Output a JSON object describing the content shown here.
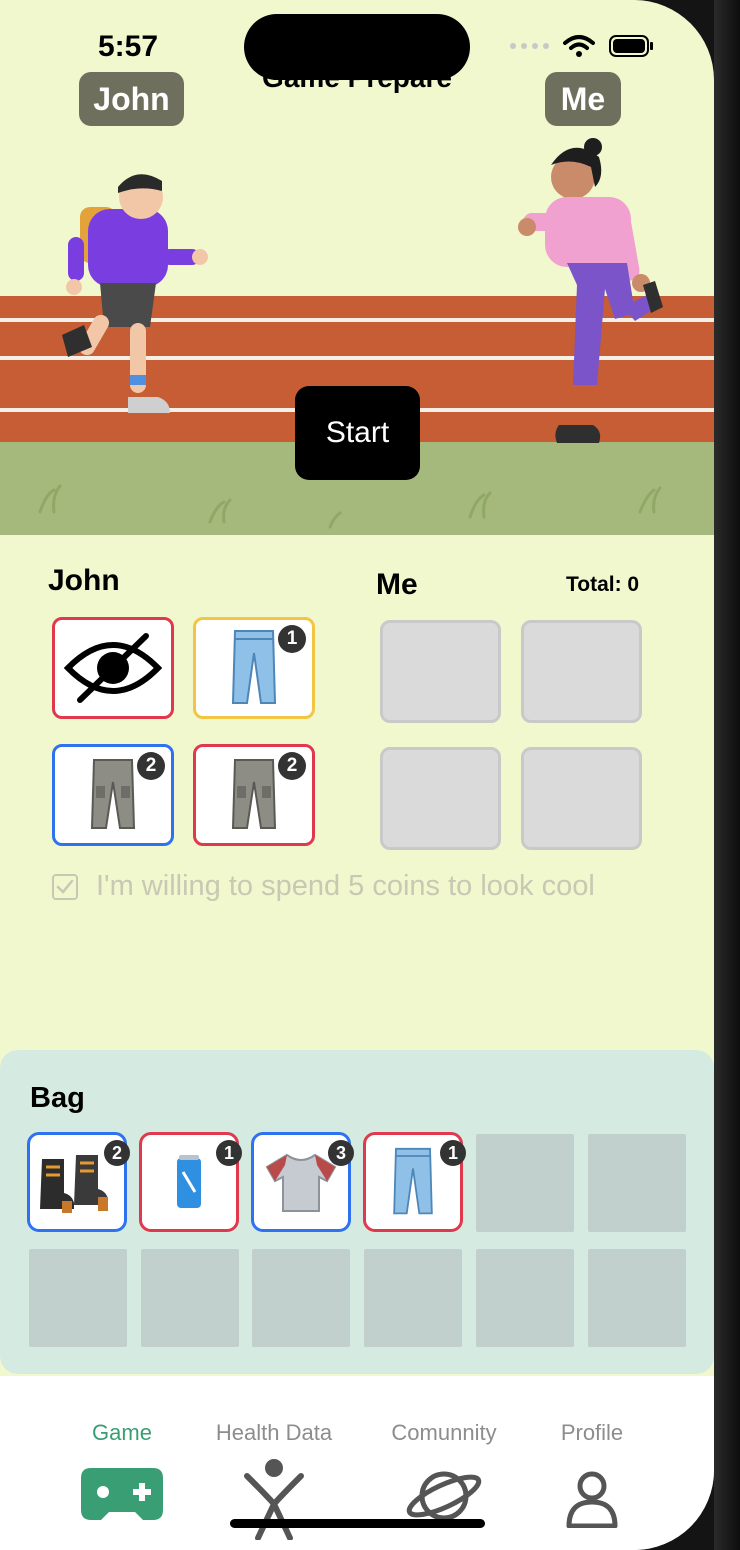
{
  "status_bar": {
    "time": "5:57"
  },
  "hero": {
    "title": "Game Prepare",
    "left_player": "John",
    "right_player": "Me",
    "start_label": "Start"
  },
  "equipment": {
    "left_heading": "John",
    "right_heading": "Me",
    "total_label": "Total: 0",
    "left_slots": [
      {
        "icon": "hidden-eye-icon",
        "border": "#e0394d"
      },
      {
        "icon": "jeans-icon",
        "badge": "1",
        "border": "#f2c644"
      },
      {
        "icon": "cargo-pants-icon",
        "badge": "2",
        "border": "#2f72f0"
      },
      {
        "icon": "cargo-pants-icon",
        "badge": "2",
        "border": "#e0394d"
      }
    ],
    "checkbox_label": "I'm willing to spend 5 coins to look cool",
    "checkbox_checked": true
  },
  "bag": {
    "title": "Bag",
    "items": [
      {
        "icon": "boots-icon",
        "badge": "2",
        "border": "#2f72f0"
      },
      {
        "icon": "energy-drink-can-icon",
        "badge": "1",
        "border": "#e0394d"
      },
      {
        "icon": "tshirt-icon",
        "badge": "3",
        "border": "#2f72f0"
      },
      {
        "icon": "jeans-icon",
        "badge": "1",
        "border": "#e0394d"
      }
    ]
  },
  "tabs": [
    {
      "label": "Game",
      "icon": "gamepad-icon",
      "active": true
    },
    {
      "label": "Health Data",
      "icon": "fitness-person-icon",
      "active": false
    },
    {
      "label": "Comunnity",
      "icon": "planet-icon",
      "active": false
    },
    {
      "label": "Profile",
      "icon": "person-icon",
      "active": false
    }
  ],
  "colors": {
    "background": "#f2f8cd",
    "track": "#c65d34",
    "grass": "#a5b97c",
    "bag_background": "#d5ebe2",
    "active_tab": "#3a9e74",
    "rarity_red": "#e0394d",
    "rarity_blue": "#2f72f0",
    "rarity_yellow": "#f2c644"
  }
}
